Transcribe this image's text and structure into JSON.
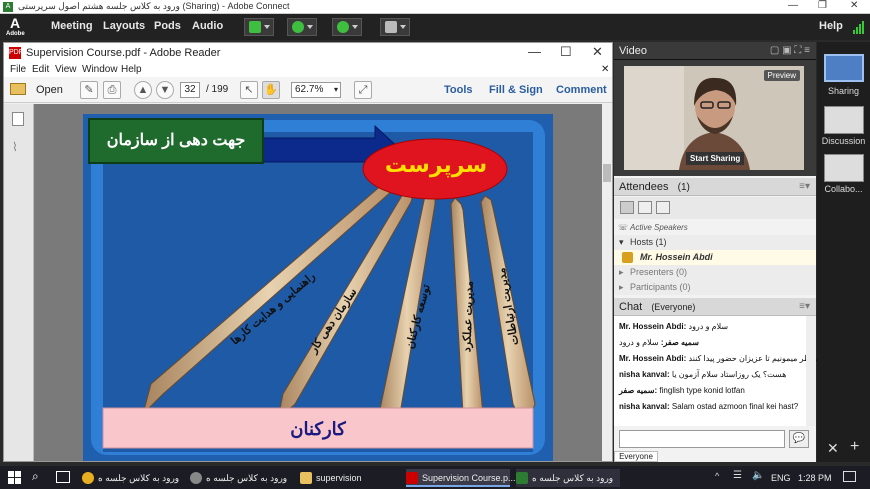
{
  "window": {
    "title": "ورود به کلاس جلسه هشتم اصول سرپرستی (Sharing) - Adobe Connect"
  },
  "menubar": {
    "logo": "A",
    "logo_sub": "Adobe",
    "items": [
      "Meeting",
      "Layouts",
      "Pods",
      "Audio"
    ],
    "help": "Help"
  },
  "reader": {
    "title": "Supervision Course.pdf - Adobe Reader",
    "menu": [
      "File",
      "Edit",
      "View",
      "Window",
      "Help"
    ],
    "open_label": "Open",
    "page_current": "32",
    "page_total": "/ 199",
    "zoom": "62.7%",
    "tools": "Tools",
    "fill_sign": "Fill & Sign",
    "comment": "Comment"
  },
  "slide": {
    "header_box": "جهت دهی از سازمان",
    "supervisor": "سرپرست",
    "arrows": [
      "راهنمایی و هدایت کارها",
      "سازمان دهی کار",
      "توسعه کارکنان",
      "مدیریت عملکرد",
      "مدیریت ارتباطات"
    ],
    "footer": "کارکنان"
  },
  "video": {
    "header": "Video",
    "preview": "Preview",
    "start_sharing": "Start Sharing"
  },
  "attendees": {
    "header": "Attendees",
    "count": "(1)",
    "active_speakers": "Active Speakers",
    "hosts": "Hosts (1)",
    "host_name": "Mr. Hossein Abdi",
    "presenters": "Presenters (0)",
    "participants": "Participants (0)"
  },
  "chat": {
    "header": "Chat",
    "scope": "(Everyone)",
    "messages": [
      {
        "from": "Mr. Hossein Abdi:",
        "text": "سلام و درود"
      },
      {
        "from": "",
        "text": "سلام و درود",
        "from_rtl": "سمیه صفر:"
      },
      {
        "from": "Mr. Hossein Abdi:",
        "text": "منتظر میمونیم تا عزیزان حضور پیدا کنند"
      },
      {
        "from": "nisha kanval:",
        "text": "هست؟ یک روزاستاد سلام آزمون یا"
      },
      {
        "from": "",
        "text": "finglish type konid lotfan",
        "from_rtl": "سمیه صفر:"
      },
      {
        "from": "nisha kanval:",
        "text": "Salam ostad azmoon final kei hast?"
      }
    ],
    "tab": "Everyone"
  },
  "rail": {
    "items": [
      "Sharing",
      "Discussion",
      "Collabo..."
    ]
  },
  "taskbar": {
    "items": [
      "ورود به کلاس جلسه ه",
      "ورود به کلاس جلسه ه",
      "supervision",
      "Supervision Course.p...",
      "ورود به کلاس جلسه ه"
    ],
    "lang": "ENG",
    "time": "1:28 PM"
  },
  "colors": {
    "accent": "#2a5d9f",
    "slide_blue": "#2c6cc0",
    "supervisor_red": "#e0141e",
    "supervisor_text": "#ffe000",
    "header_green": "#1f6b2e"
  }
}
